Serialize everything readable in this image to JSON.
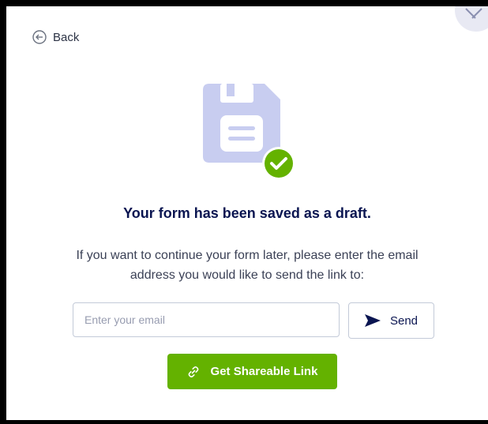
{
  "dialog": {
    "back_label": "Back",
    "title": "Your form has been saved as a draft.",
    "description": "If you want to continue your form later, please enter the email address you would like to send the link to:",
    "email_placeholder": "Enter your email",
    "email_value": "",
    "send_label": "Send",
    "share_label": "Get Shareable Link"
  },
  "icons": {
    "close": "close-icon",
    "back": "arrow-left-circle-icon",
    "hero": "floppy-disk-icon",
    "check": "check-circle-icon",
    "send": "send-arrow-icon",
    "link": "link-icon"
  },
  "colors": {
    "accent_green": "#64b200",
    "navy": "#0a1551",
    "disk": "#c8cdf0",
    "border": "#c3cad8"
  }
}
